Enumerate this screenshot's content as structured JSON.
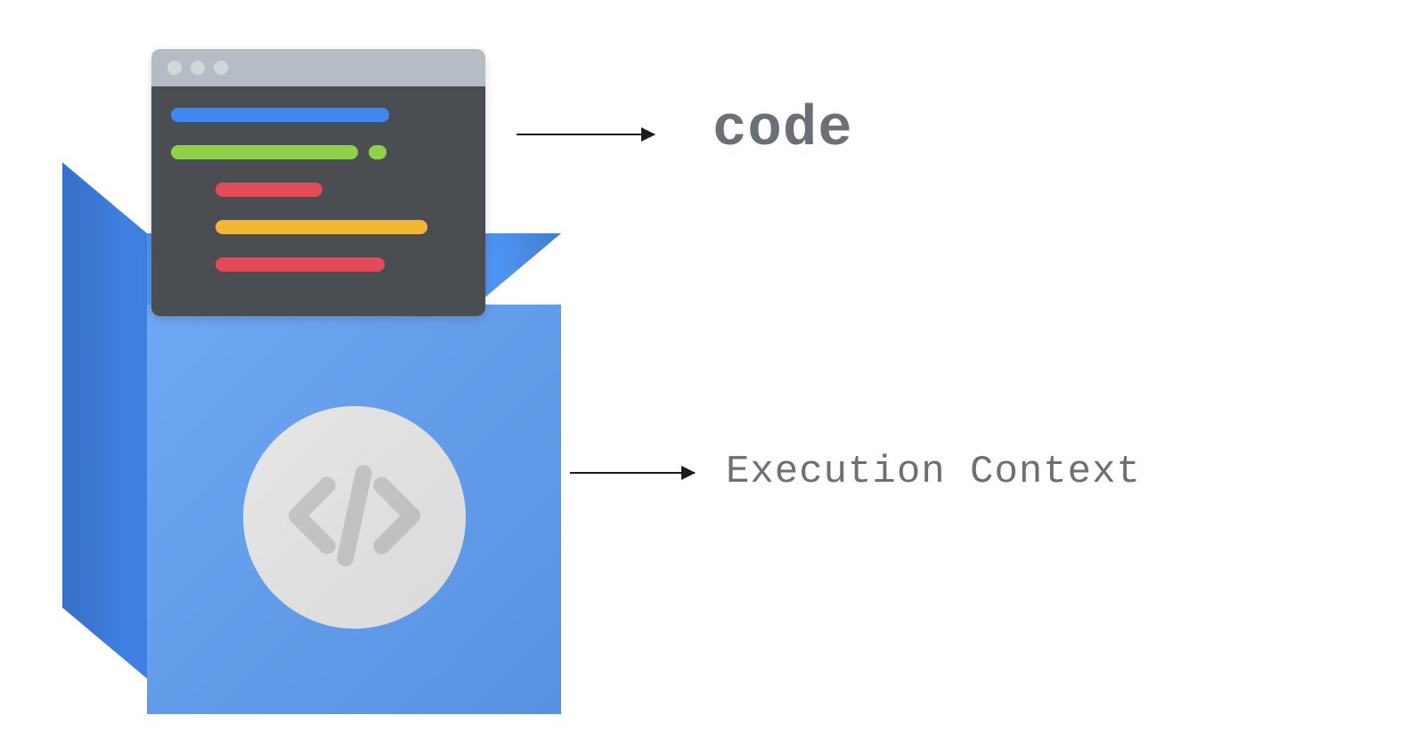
{
  "labels": {
    "code": "code",
    "execution_context": "Execution Context"
  },
  "icons": {
    "code_badge": "code-angle-brackets-icon"
  },
  "colors": {
    "box_front": "#5e9ef3",
    "box_side": "#3e7fe0",
    "box_top": "#4f96f5",
    "window_titlebar": "#b5bcc3",
    "window_body": "#4a4e52",
    "line_blue": "#4187f0",
    "line_green": "#8fd14b",
    "line_red": "#e44a57",
    "line_yellow": "#f1b836",
    "badge_bg": "#e8e8e8",
    "text": "#6b6f76",
    "arrow": "#1b1b1b"
  },
  "code_window": {
    "lines": [
      {
        "color": "blue",
        "indent": 0,
        "trailing_dot": false
      },
      {
        "color": "green",
        "indent": 0,
        "trailing_dot": true
      },
      {
        "color": "red",
        "indent": 1,
        "trailing_dot": false
      },
      {
        "color": "yellow",
        "indent": 1,
        "trailing_dot": false
      },
      {
        "color": "red",
        "indent": 1,
        "trailing_dot": false
      }
    ]
  },
  "diagram": {
    "items": [
      {
        "name": "code-window",
        "points_to_label": "code"
      },
      {
        "name": "execution-context-box",
        "points_to_label": "execution_context"
      }
    ]
  }
}
